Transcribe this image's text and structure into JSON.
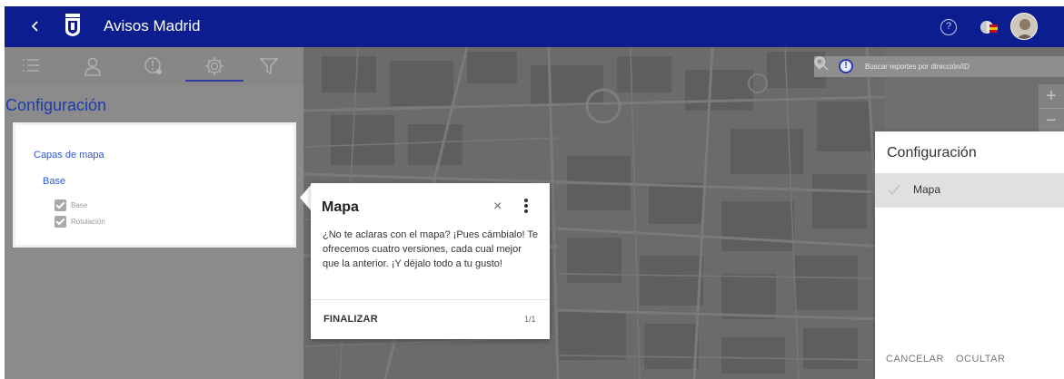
{
  "header": {
    "back_icon": "chevron-left-icon",
    "title": "Avisos Madrid",
    "help_label": "?",
    "colors": {
      "bar": "#0c1e8f",
      "text": "#ffffff"
    }
  },
  "left_panel": {
    "tabs": [
      {
        "icon": "list-icon"
      },
      {
        "icon": "user-icon"
      },
      {
        "icon": "alert-clock-icon"
      },
      {
        "icon": "gear-icon",
        "active": true
      },
      {
        "icon": "filter-icon"
      }
    ],
    "title": "Configuración",
    "card": {
      "title": "Capas de mapa",
      "group": "Base",
      "layers": [
        {
          "label": "Base",
          "checked": true
        },
        {
          "label": "Rotulación",
          "checked": true
        }
      ]
    }
  },
  "map": {
    "search": {
      "alert_symbol": "!",
      "placeholder": "Buscar reportes por dirección/ID"
    },
    "zoom_in": "+",
    "zoom_out": "−"
  },
  "popover": {
    "title": "Mapa",
    "close": "×",
    "body": "¿No te aclaras con el mapa? ¡Pues cámbialo! Te ofrecemos cuatro versiones, cada cual mejor que la anterior. ¡Y déjalo todo a tu gusto!",
    "finish": "FINALIZAR",
    "counter": "1/1"
  },
  "config_panel": {
    "title": "Configuración",
    "items": [
      {
        "label": "Mapa",
        "selected": true
      }
    ],
    "cancel": "CANCELAR",
    "hide": "OCULTAR"
  }
}
